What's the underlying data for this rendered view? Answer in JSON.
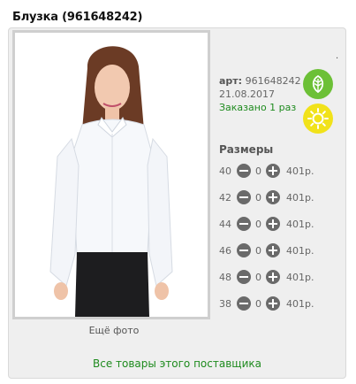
{
  "product": {
    "title": "Блузка (961648242)",
    "art_label": "арт:",
    "art_value": "961648242",
    "date": "21.08.2017",
    "ordered": "Заказано 1 раз",
    "more_photo": "Ещё фото",
    "dot": "."
  },
  "icons": {
    "eco": "leaf-icon",
    "season": "sun-icon",
    "eco_color": "#6cc036",
    "season_color": "#f1e21a"
  },
  "sizes": {
    "title": "Размеры",
    "rows": [
      {
        "size": "40",
        "qty": "0",
        "price": "401р."
      },
      {
        "size": "42",
        "qty": "0",
        "price": "401р."
      },
      {
        "size": "44",
        "qty": "0",
        "price": "401р."
      },
      {
        "size": "46",
        "qty": "0",
        "price": "401р."
      },
      {
        "size": "48",
        "qty": "0",
        "price": "401р."
      },
      {
        "size": "38",
        "qty": "0",
        "price": "401р."
      }
    ]
  },
  "footer": {
    "supplier_link": "Все товары этого поставщика",
    "link_color": "#1e8b1e"
  }
}
